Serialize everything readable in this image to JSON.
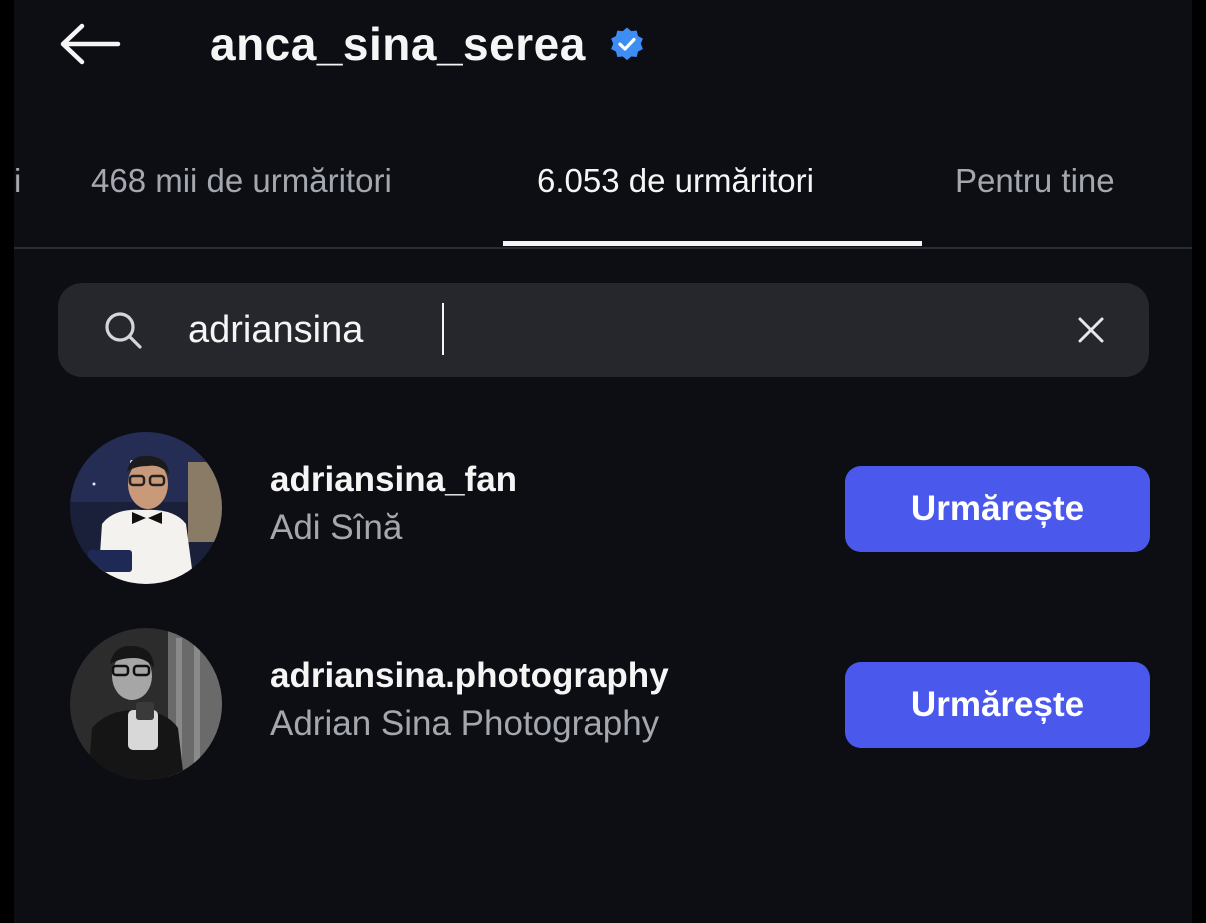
{
  "header": {
    "title": "anca_sina_serea",
    "back_icon": "arrow-left-icon",
    "verified_icon": "verified-badge-icon",
    "verified_color": "#3d8df5"
  },
  "tabs": [
    {
      "label": "i",
      "active": false
    },
    {
      "label": "468 mii de urmăritori",
      "active": false
    },
    {
      "label": "6.053 de urmăritori",
      "active": true
    },
    {
      "label": "Pentru tine",
      "active": false
    }
  ],
  "search": {
    "value": "adriansina",
    "search_icon": "search-icon",
    "clear_icon": "close-icon"
  },
  "results": [
    {
      "username": "adriansina_fan",
      "fullname": "Adi Sînă",
      "button_label": "Urmărește"
    },
    {
      "username": "adriansina.photography",
      "fullname": "Adrian Sina Photography",
      "button_label": "Urmărește"
    }
  ],
  "colors": {
    "background": "#0c0e14",
    "search_bg": "#25272c",
    "accent_button": "#4b58ec",
    "secondary_text": "#a4a7ae"
  }
}
